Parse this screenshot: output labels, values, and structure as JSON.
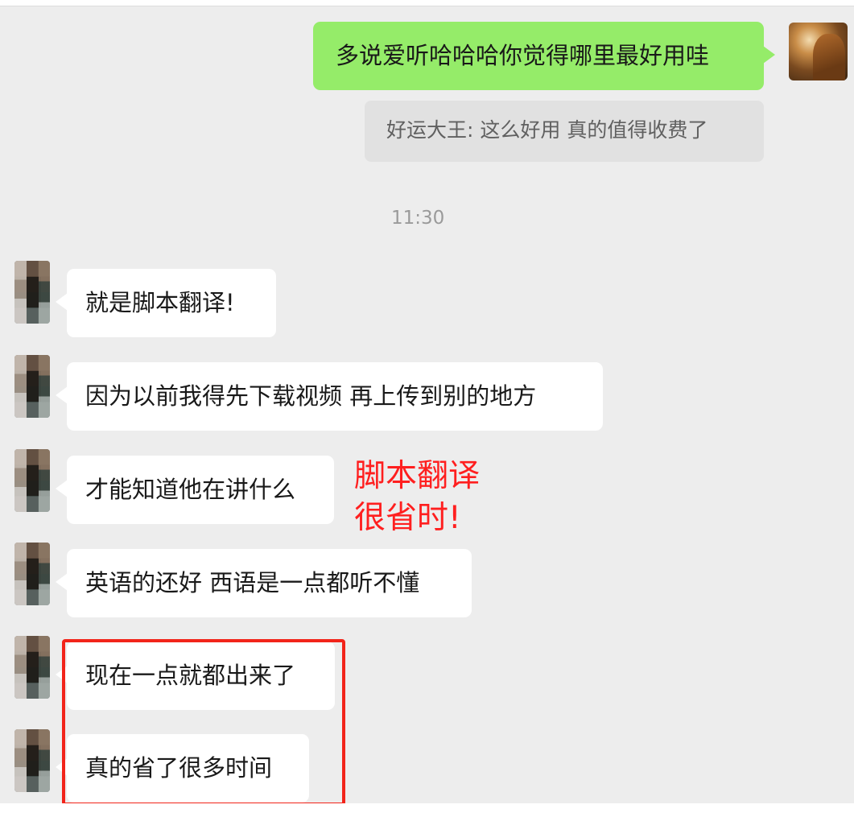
{
  "outgoing_message": "多说爱听哈哈哈你觉得哪里最好用哇",
  "quoted_reply": "好运大王: 这么好用 真的值得收费了",
  "timestamp": "11:30",
  "incoming_messages": [
    "就是脚本翻译!",
    "因为以前我得先下载视频 再上传到别的地方",
    "才能知道他在讲什么",
    "英语的还好 西语是一点都听不懂",
    "现在一点就都出来了",
    "真的省了很多时间"
  ],
  "annotation": {
    "line1": "脚本翻译",
    "line2": "很省时!",
    "color": "#ff1f1f"
  },
  "colors": {
    "outgoing_bubble": "#95ec69",
    "incoming_bubble": "#ffffff",
    "chat_background": "#ededed",
    "highlight_box": "#f2241a"
  }
}
